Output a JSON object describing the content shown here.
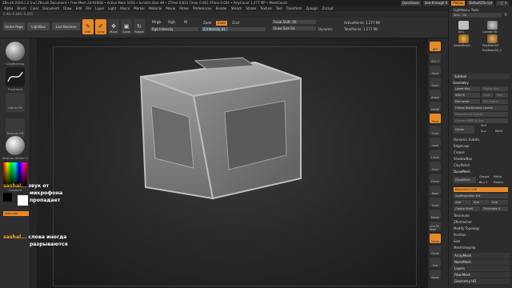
{
  "titlebar": {
    "title": "ZBrush 2019.1.2 [nu]   ZBrush Document   • Free Mem 24.919GB • Active Mem 1054 • Scratch Disk 48 • ZTime 0.833 Timer 0.001 ATime 0.004 • PolyCount 1.277 MP • MeshCount",
    "quicksave": "QuickSave",
    "seethrough": "See-through 0",
    "menus": "Menus",
    "default_script": "DefaultZScript",
    "window_icons": "– □ ×"
  },
  "menubar": {
    "items": [
      "Alpha",
      "Brush",
      "Color",
      "Document",
      "Draw",
      "Edit",
      "File",
      "Layer",
      "Light",
      "Macro",
      "Marker",
      "Material",
      "Movie",
      "Picker",
      "Preferences",
      "Render",
      "Stencil",
      "Stroke",
      "Texture",
      "Tool",
      "Transform",
      "Zplugin",
      "Zscript"
    ]
  },
  "coords": "0.98,-0.849,-0.695",
  "topbar": {
    "home_page": "Home Page",
    "lightbox": "LightBox",
    "live_boolean": "Live Boolean",
    "tools": [
      {
        "label": "Edit",
        "glyph": "✎",
        "active": true
      },
      {
        "label": "Draw",
        "glyph": "✐",
        "active": true
      },
      {
        "label": "Move",
        "glyph": "✥",
        "active": false
      },
      {
        "label": "Scale",
        "glyph": "▣",
        "active": false
      },
      {
        "label": "Rotate",
        "glyph": "↻",
        "active": false
      }
    ],
    "mrgb": "Mrgb",
    "rgb": "Rgb",
    "m": "M",
    "rgb_intensity": "Rgb Intensity",
    "zadd": "Zadd",
    "zsub": "Zsub",
    "zcut": "Zcut",
    "z_intensity": "Z Intensity 41",
    "z_intensity_value": 41,
    "focal_shift": "Focal Shift -56",
    "draw_size": "Draw Size 64",
    "dynamic": "Dynamic",
    "active_points": "ActivePoints: 1.277 Mil",
    "total_points": "TotalPoints: 1.277 Mil"
  },
  "leftshelf": {
    "brush_label": "ClayBuildup",
    "stroke_label": "FreeHand",
    "alpha_label": "Alpha Off",
    "texture_label": "Texture Off",
    "material_label": "MatCap White Ci",
    "gradient_label": "Gradient",
    "switch_label": "SwitchColor",
    "alternate_label": "Alternate"
  },
  "right_bar": {
    "buttons": [
      "BPR",
      "SPix 3",
      "Scroll",
      "Zoom",
      "Actual",
      "AAHalf",
      "Persp",
      "Floor",
      "Local",
      "L.Sym",
      "Gxyz",
      "Frame",
      "Move",
      "Scale",
      "Rotate",
      "Line Fill PolyF",
      "Transp",
      "Ghost",
      "Solo",
      "Xpose"
    ]
  },
  "rpanel": {
    "lightbox_tools": "Lightbox ▸ Tools",
    "tool_name": "Sm1 . 50",
    "r_label": "R",
    "thumbs": [
      "Sm1",
      "Cylinder3D",
      "SimpleBrush",
      "PolyMesh3D",
      "PolyMesh3D_1"
    ],
    "subtool": "Subtool",
    "geometry": "Geometry",
    "lower_res": "Lower Res",
    "higher_res": "Higher Res",
    "sdiv": "SDiv 8",
    "cage": "Cage",
    "rstr": "Rstr",
    "del_lower": "Del Lower",
    "del_higher": "Del Higher",
    "freeze_subdiv": "Freeze SubDivision Levels",
    "reconstruct": "Reconstruct Subdiv",
    "convert_bpr": "Convert BPR To Geo",
    "divide": "Divide",
    "smt": "Smt",
    "suv": "Suv",
    "reuv": "ReUV",
    "dynamic_subdiv": "Dynamic Subdiv",
    "edgeloop": "EdgeLoop",
    "crease": "Crease",
    "shadowbox": "ShadowBox",
    "claypolish": "ClayPolish",
    "dynamesh": "DynaMesh",
    "dynamesh_btn": "DynaMesh",
    "groups": "Groups",
    "polish": "Polish",
    "blur": "Blur 2",
    "project": "Project",
    "resolution": "Resolution 128",
    "subprojection": "SubProjection 0.6",
    "add": "Add",
    "sub": "Sub",
    "and": "And",
    "create_shell": "Create Shell",
    "thickness": "Thickness 4",
    "tessimate": "Tessimate",
    "zremesher": "ZRemesher",
    "modify_topology": "Modify Topology",
    "position": "Position",
    "size": "Size",
    "meshintegrity": "MeshIntegrity",
    "arraymesh": "ArrayMesh",
    "nanomesh": "NanoMesh",
    "layers": "Layers",
    "fibermesh": "FiberMesh",
    "geometry_hd": "Geometry HD"
  },
  "chat": {
    "user1": "sashal...",
    "msg1_line1": "звук от",
    "msg1_line2": "микрофона",
    "msg1_line3": "пропадает",
    "user2": "sashal...",
    "msg2_line1": "слова иногда",
    "msg2_line2": "разрываются"
  },
  "colors": {
    "accent": "#e98a2a",
    "mesh": "#9a9a9a",
    "chat_user": "#f2a91a"
  }
}
